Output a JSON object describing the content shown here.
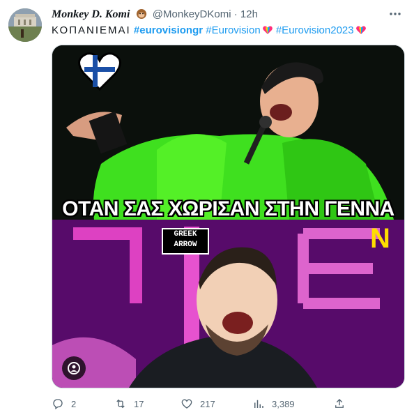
{
  "user": {
    "display_name": "Monkey D. Komi",
    "handle": "@MonkeyDKomi",
    "separator": "·",
    "time": "12h"
  },
  "tweet": {
    "text_plain": "ΚΟΠΑΝΙΕΜΑΙ",
    "hashtags": [
      "#eurovisiongr",
      "#Eurovision",
      "#Eurovision2023"
    ]
  },
  "media": {
    "caption": "ΟΤΑΝ ΣΑΣ ΧΩΡΙΣΑΝ ΣΤΗΝ ΓΕΝΝΑ",
    "logo_line1": "GREEK",
    "logo_line2": "ARROW",
    "n_logo": "N"
  },
  "actions": {
    "replies": "2",
    "retweets": "17",
    "likes": "217",
    "views": "3,389"
  },
  "colors": {
    "accent": "#1d9bf0",
    "muted": "#536471"
  }
}
